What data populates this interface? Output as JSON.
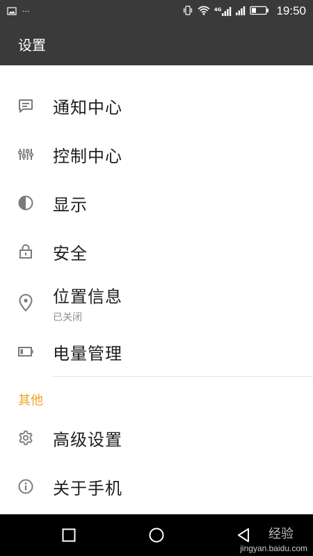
{
  "status_bar": {
    "time": "19:50",
    "network_label": "4G",
    "dots": "···",
    "icons": [
      "image-icon",
      "vibrate-icon",
      "wifi-icon",
      "signal-icon",
      "signal-icon",
      "battery-icon"
    ]
  },
  "app_bar": {
    "title": "设置"
  },
  "menu": {
    "items": [
      {
        "label": "通知中心",
        "icon": "message-icon"
      },
      {
        "label": "控制中心",
        "icon": "sliders-icon"
      },
      {
        "label": "显示",
        "icon": "contrast-icon"
      },
      {
        "label": "安全",
        "icon": "lock-icon"
      },
      {
        "label": "位置信息",
        "subtitle": "已关闭",
        "icon": "location-pin-icon"
      },
      {
        "label": "电量管理",
        "icon": "battery-icon"
      }
    ],
    "section_other": "其他",
    "other_items": [
      {
        "label": "高级设置",
        "icon": "gear-icon"
      },
      {
        "label": "关于手机",
        "icon": "info-icon"
      }
    ]
  },
  "nav_bar": {
    "icons": [
      "back-icon",
      "home-icon",
      "recent-apps-icon"
    ]
  },
  "watermark": {
    "title": "经验",
    "url": "jingyan.baidu.com"
  },
  "colors": {
    "bar": "#3a3a3a",
    "accent": "#f0a321",
    "icon": "#7a7a7a"
  }
}
